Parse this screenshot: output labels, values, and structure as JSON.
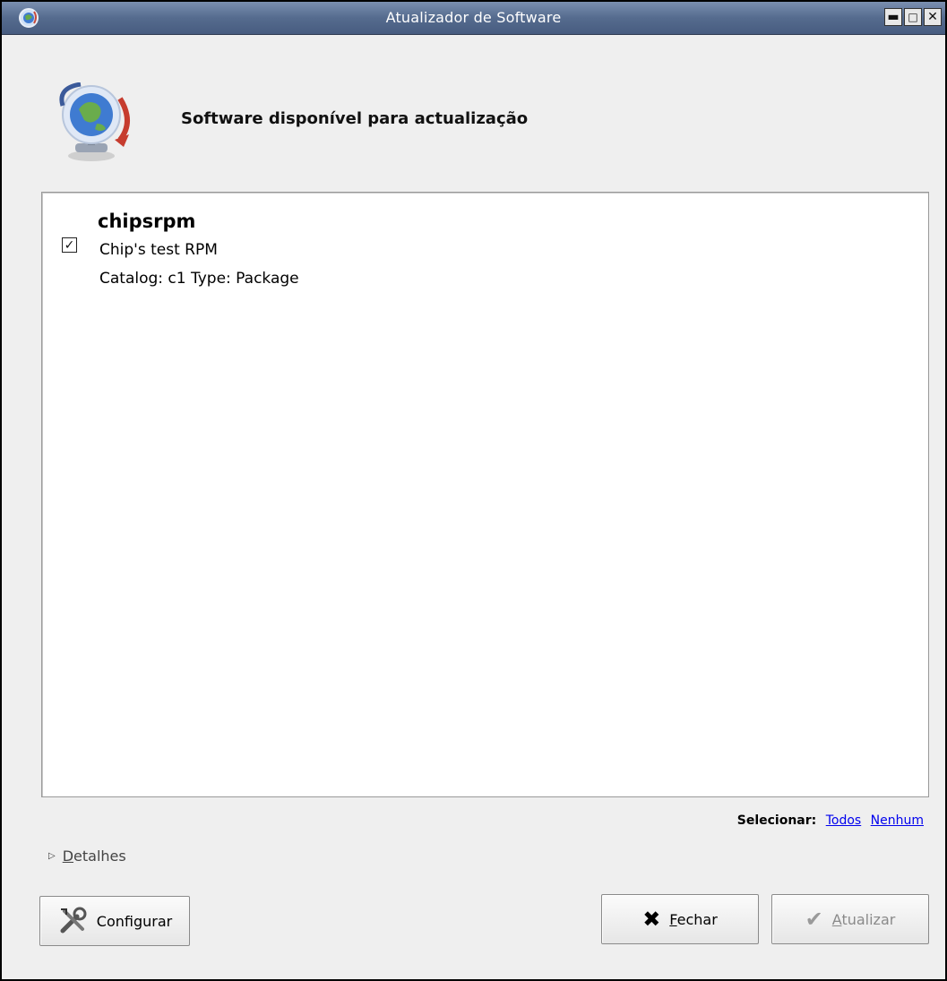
{
  "window": {
    "title": "Atualizador de Software",
    "controls": [
      "minimize",
      "maximize",
      "close"
    ]
  },
  "header": {
    "icon": "globe-update-icon",
    "title": "Software disponível para actualização"
  },
  "packages": [
    {
      "name": "chipsrpm",
      "description": "Chip's test RPM",
      "meta": "Catalog: c1 Type: Package",
      "checked": true
    }
  ],
  "select": {
    "label": "Selecionar:",
    "all": "Todos",
    "none": "Nenhum"
  },
  "details": {
    "label": "Detalhes"
  },
  "buttons": {
    "configure": "Configurar",
    "close": "Fechar",
    "update": "Atualizar"
  }
}
